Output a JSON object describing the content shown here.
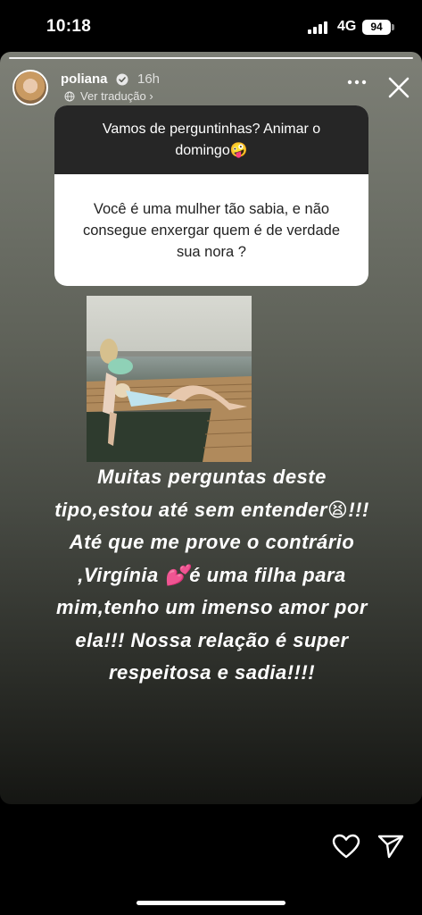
{
  "status_bar": {
    "time": "10:18",
    "network": "4G",
    "battery": "94"
  },
  "story": {
    "username": "poliana",
    "posted_ago": "16h",
    "translate_link": "Ver tradução",
    "question_sticker": {
      "prompt": "Vamos de perguntinhas? Animar o domingo🤪",
      "question": "Você é uma mulher tão sabia, e não consegue enxergar quem é de verdade sua nora ?"
    },
    "caption": "Muitas perguntas deste tipo,estou até sem entender😫!!! Até que me prove o contrário ,Virgínia 💕é uma filha para mim,tenho um imenso amor por ela!!! Nossa relação é super respeitosa e sadia!!!!"
  },
  "icons": {
    "verified": "verified-badge-icon",
    "globe": "globe-icon",
    "more": "more-options-icon",
    "close": "close-icon",
    "like": "heart-icon",
    "share": "send-icon"
  },
  "colors": {
    "sticker_header": "#262626",
    "sticker_body": "#ffffff"
  }
}
